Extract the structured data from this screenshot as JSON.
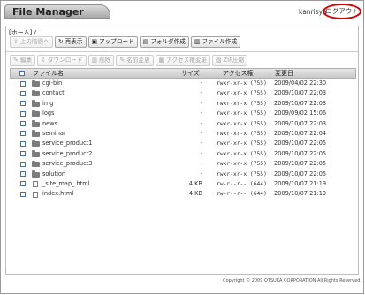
{
  "app": {
    "title": "File Manager",
    "username": "kanrisya",
    "logout_label": "ログアウト"
  },
  "breadcrumb": "[ホーム] /",
  "toolbar1": [
    {
      "label": "上の階層へ",
      "icon": "up-arrow-icon",
      "enabled": false
    },
    {
      "label": "再表示",
      "icon": "refresh-icon",
      "enabled": true
    },
    {
      "label": "アップロード",
      "icon": "upload-icon",
      "enabled": true
    },
    {
      "label": "フォルダ作成",
      "icon": "folder-create-icon",
      "enabled": true
    },
    {
      "label": "ファイル作成",
      "icon": "file-create-icon",
      "enabled": true
    }
  ],
  "toolbar2": [
    {
      "label": "編集",
      "icon": "edit-icon",
      "enabled": false
    },
    {
      "label": "ダウンロード",
      "icon": "download-icon",
      "enabled": false
    },
    {
      "label": "削除",
      "icon": "delete-icon",
      "enabled": false
    },
    {
      "label": "名前変更",
      "icon": "rename-icon",
      "enabled": false
    },
    {
      "label": "アクセス権変更",
      "icon": "permission-icon",
      "enabled": false
    },
    {
      "label": "ZIP圧縮",
      "icon": "zip-icon",
      "enabled": false
    }
  ],
  "table": {
    "headers": {
      "name": "ファイル名",
      "size": "サイズ",
      "perm": "アクセス権",
      "date": "変更日"
    },
    "rows": [
      {
        "type": "folder",
        "name": "cgi-bin",
        "size": "-",
        "perm": "rwxr-xr-x (755)",
        "date": "2009/04/02 22:30"
      },
      {
        "type": "folder",
        "name": "contact",
        "size": "-",
        "perm": "rwxr-xr-x (755)",
        "date": "2009/10/07 22:03"
      },
      {
        "type": "folder",
        "name": "img",
        "size": "-",
        "perm": "rwxr-xr-x (755)",
        "date": "2009/10/07 22:03"
      },
      {
        "type": "folder",
        "name": "logs",
        "size": "-",
        "perm": "rwxr-xr-x (755)",
        "date": "2009/09/02 15:06"
      },
      {
        "type": "folder",
        "name": "news",
        "size": "-",
        "perm": "rwxr-xr-x (755)",
        "date": "2009/10/07 22:03"
      },
      {
        "type": "folder",
        "name": "seminar",
        "size": "-",
        "perm": "rwxr-xr-x (755)",
        "date": "2009/10/07 22:04"
      },
      {
        "type": "folder",
        "name": "service_product1",
        "size": "-",
        "perm": "rwxr-xr-x (755)",
        "date": "2009/10/07 22:05"
      },
      {
        "type": "folder",
        "name": "service_product2",
        "size": "-",
        "perm": "rwxr-xr-x (755)",
        "date": "2009/10/07 22:05"
      },
      {
        "type": "folder",
        "name": "service_product3",
        "size": "-",
        "perm": "rwxr-xr-x (755)",
        "date": "2009/10/07 22:05"
      },
      {
        "type": "folder",
        "name": "solution",
        "size": "-",
        "perm": "rwxr-xr-x (755)",
        "date": "2009/10/07 22:05"
      },
      {
        "type": "file",
        "name": "_site_map_.html",
        "size": "4 KB",
        "perm": "rw-r--r-- (644)",
        "date": "2009/10/07 21:19"
      },
      {
        "type": "file",
        "name": "index.html",
        "size": "4 KB",
        "perm": "rw-r--r-- (644)",
        "date": "2009/10/07 21:19"
      }
    ]
  },
  "footer": {
    "copyright": "Copyright © 2009 OTSUKA CORPORATION All Rights Reserved."
  },
  "colors": {
    "logout_highlight": "#d40000",
    "header_gradient_top": "#e6e6e6",
    "header_gradient_bottom": "#c9c9c9"
  }
}
